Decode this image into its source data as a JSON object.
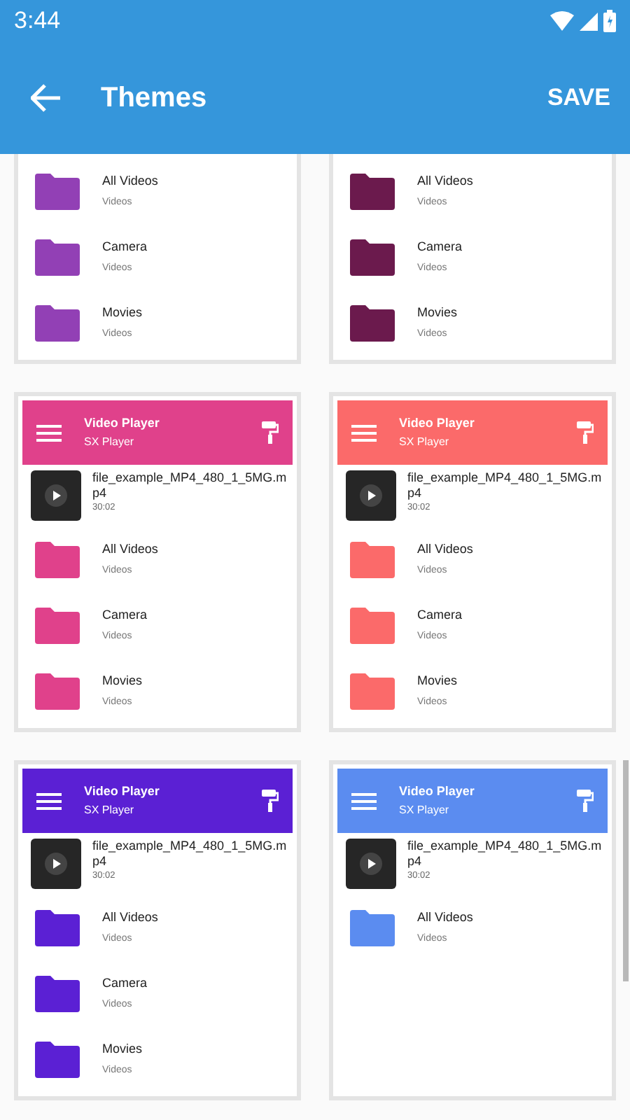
{
  "status_bar": {
    "time": "3:44"
  },
  "app_bar": {
    "title": "Themes",
    "action": "SAVE"
  },
  "cards": [
    {
      "color": "#9240b5",
      "folders": [
        {
          "name": "All Videos",
          "sub": "Videos"
        },
        {
          "name": "Camera",
          "sub": "Videos"
        },
        {
          "name": "Movies",
          "sub": "Videos"
        }
      ]
    },
    {
      "color": "#6b1a4d",
      "folders": [
        {
          "name": "All Videos",
          "sub": "Videos"
        },
        {
          "name": "Camera",
          "sub": "Videos"
        },
        {
          "name": "Movies",
          "sub": "Videos"
        }
      ]
    },
    {
      "color": "#e0418b",
      "header": {
        "title": "Video Player",
        "subtitle": "SX Player"
      },
      "file": {
        "name": "file_example_MP4_480_1_5MG.mp4",
        "duration": "30:02"
      },
      "folders": [
        {
          "name": "All Videos",
          "sub": "Videos"
        },
        {
          "name": "Camera",
          "sub": "Videos"
        },
        {
          "name": "Movies",
          "sub": "Videos"
        }
      ]
    },
    {
      "color": "#fb6a6a",
      "header": {
        "title": "Video Player",
        "subtitle": "SX Player"
      },
      "file": {
        "name": "file_example_MP4_480_1_5MG.mp4",
        "duration": "30:02"
      },
      "folders": [
        {
          "name": "All Videos",
          "sub": "Videos"
        },
        {
          "name": "Camera",
          "sub": "Videos"
        },
        {
          "name": "Movies",
          "sub": "Videos"
        }
      ]
    },
    {
      "color": "#5b20d4",
      "header": {
        "title": "Video Player",
        "subtitle": "SX Player"
      },
      "file": {
        "name": "file_example_MP4_480_1_5MG.mp4",
        "duration": "30:02"
      },
      "folders": [
        {
          "name": "All Videos",
          "sub": "Videos"
        },
        {
          "name": "Camera",
          "sub": "Videos"
        },
        {
          "name": "Movies",
          "sub": "Videos"
        }
      ]
    },
    {
      "color": "#5b8cf0",
      "header": {
        "title": "Video Player",
        "subtitle": "SX Player"
      },
      "file": {
        "name": "file_example_MP4_480_1_5MG.mp4",
        "duration": "30:02"
      },
      "folders": [
        {
          "name": "All Videos",
          "sub": "Videos"
        }
      ]
    }
  ]
}
